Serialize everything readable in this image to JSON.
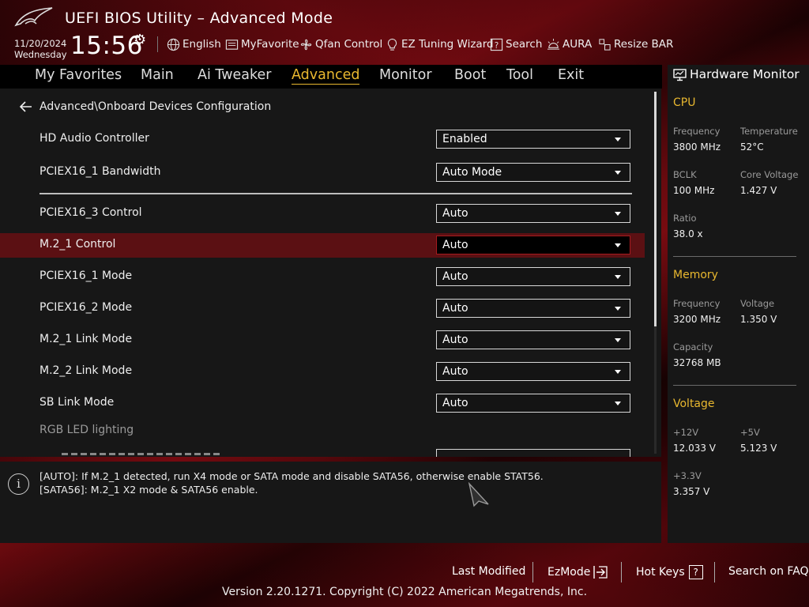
{
  "header": {
    "title": "UEFI BIOS Utility – Advanced Mode",
    "date": "11/20/2024",
    "weekday": "Wednesday",
    "time": "15:56",
    "toolbar": {
      "language": "English",
      "myfavorite": "MyFavorite",
      "qfan": "Qfan Control",
      "ez_tuning": "EZ Tuning Wizard",
      "search": "Search",
      "aura": "AURA",
      "resize_bar": "Resize BAR"
    }
  },
  "menu": [
    "My Favorites",
    "Main",
    "Ai Tweaker",
    "Advanced",
    "Monitor",
    "Boot",
    "Tool",
    "Exit"
  ],
  "main": {
    "breadcrumb": "Advanced\\Onboard Devices Configuration",
    "rows": [
      {
        "label": "HD Audio Controller",
        "value": "Enabled"
      },
      {
        "label": "PCIEX16_1 Bandwidth",
        "value": "Auto Mode"
      },
      {
        "label": "PCIEX16_3 Control",
        "value": "Auto"
      },
      {
        "label": "M.2_1 Control",
        "value": "Auto"
      },
      {
        "label": "PCIEX16_1 Mode",
        "value": "Auto"
      },
      {
        "label": "PCIEX16_2 Mode",
        "value": "Auto"
      },
      {
        "label": "M.2_1 Link Mode",
        "value": "Auto"
      },
      {
        "label": "M.2_2 Link Mode",
        "value": "Auto"
      },
      {
        "label": "SB Link Mode",
        "value": "Auto"
      }
    ],
    "section_rgb": "RGB LED lighting"
  },
  "info": {
    "line1": "[AUTO]: If M.2_1 detected, run X4 mode or SATA mode and disable SATA56, otherwise enable STAT56.",
    "line2": "[SATA56]: M.2_1 X2 mode & SATA56 enable."
  },
  "hw_monitor": {
    "title": "Hardware Monitor",
    "cpu": {
      "heading": "CPU",
      "frequency_label": "Frequency",
      "frequency": "3800 MHz",
      "temperature_label": "Temperature",
      "temperature": "52°C",
      "bclk_label": "BCLK",
      "bclk": "100 MHz",
      "core_voltage_label": "Core Voltage",
      "core_voltage": "1.427 V",
      "ratio_label": "Ratio",
      "ratio": "38.0 x"
    },
    "memory": {
      "heading": "Memory",
      "frequency_label": "Frequency",
      "frequency": "3200 MHz",
      "voltage_label": "Voltage",
      "voltage": "1.350 V",
      "capacity_label": "Capacity",
      "capacity": "32768 MB"
    },
    "voltage": {
      "heading": "Voltage",
      "v12_label": "+12V",
      "v12": "12.033 V",
      "v5_label": "+5V",
      "v5": "5.123 V",
      "v33_label": "+3.3V",
      "v33": "3.357 V"
    }
  },
  "footer": {
    "last_modified": "Last Modified",
    "ezmode": "EzMode",
    "hotkeys": "Hot Keys",
    "hotkeys_key": "?",
    "faq": "Search on FAQ",
    "version": "Version 2.20.1271. Copyright (C) 2022 American Megatrends, Inc."
  },
  "colors": {
    "accent": "#e9b82f",
    "highlight": "#5b1013",
    "panel": "#171717"
  },
  "icons": [
    "rog-logo",
    "gear-icon",
    "globe-icon",
    "favorite-icon",
    "fan-icon",
    "bulb-icon",
    "search-icon",
    "aura-icon",
    "resize-bar-icon",
    "back-arrow-icon",
    "info-icon",
    "monitor-icon",
    "exit-icon"
  ]
}
